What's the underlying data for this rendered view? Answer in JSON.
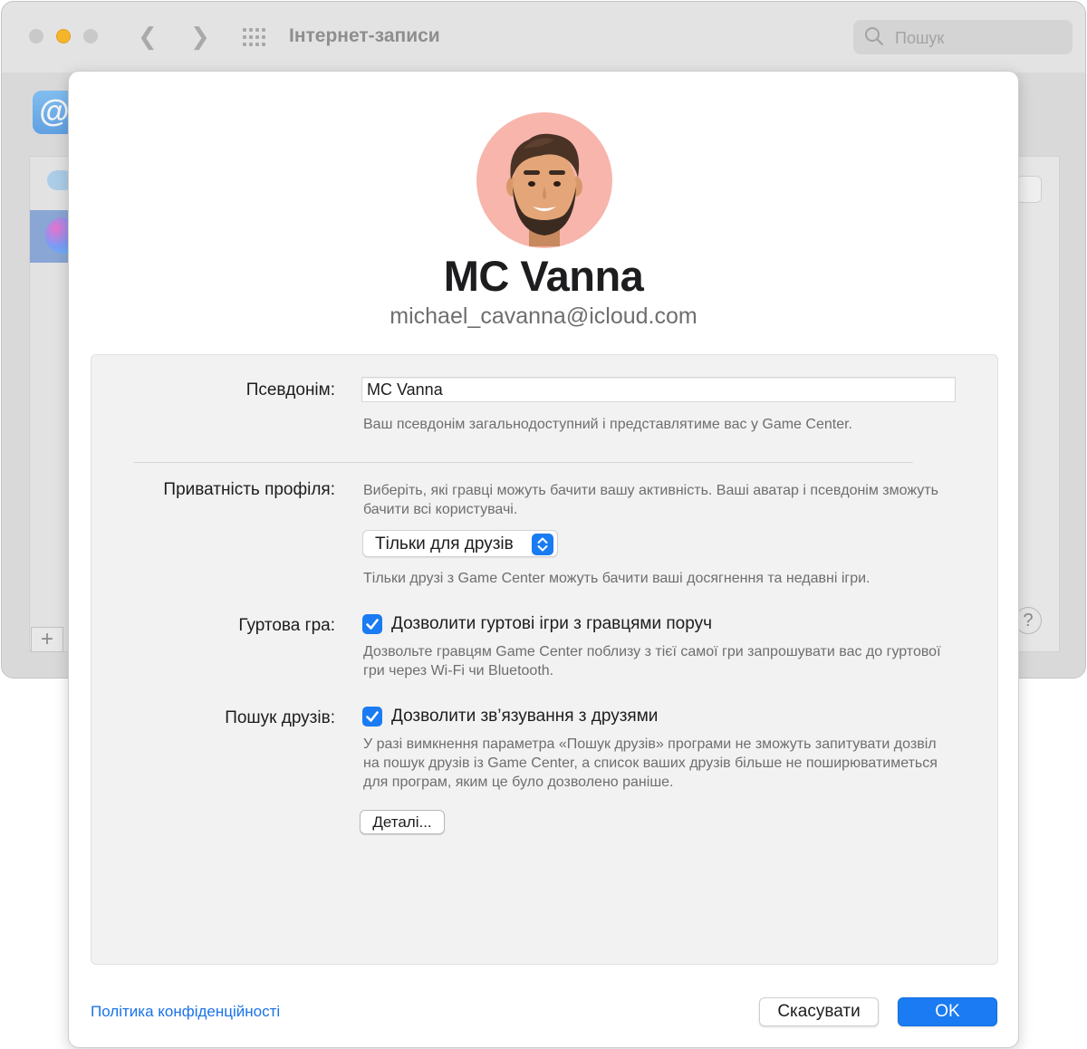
{
  "window": {
    "title": "Інтернет-записи",
    "search_placeholder": "Пошук"
  },
  "sidebar": {
    "add_label": "+",
    "help_label": "?"
  },
  "profile": {
    "name": "MC Vanna",
    "email": "michael_cavanna@icloud.com",
    "avatar_bg": "#f7b5ac"
  },
  "nickname": {
    "label": "Псевдонім:",
    "value": "MC Vanna",
    "hint": "Ваш псевдонім загальнодоступний і представлятиме вас у Game Center."
  },
  "privacy": {
    "label": "Приватність профіля:",
    "description": "Виберіть, які гравці можуть бачити вашу активність. Ваші аватар і псевдонім зможуть бачити всі користувачі.",
    "selected": "Тільки для друзів",
    "hint": "Тільки друзі з Game Center можуть бачити ваші досягнення та недавні ігри."
  },
  "multiplayer": {
    "label": "Гуртова гра:",
    "checkbox_label": "Дозволити гуртові ігри з гравцями поруч",
    "checked": true,
    "hint": "Дозвольте гравцям Game Center поблизу з тієї самої гри запрошувати вас до гуртової гри через Wi-Fi чи Bluetooth."
  },
  "friends": {
    "label": "Пошук друзів:",
    "checkbox_label": "Дозволити зв’язування з друзями",
    "checked": true,
    "hint": "У разі вимкнення параметра «Пошук друзів» програми не зможуть запитувати дозвіл на пошук друзів із Game Center, а список ваших друзів більше не поширюватиметься для програм, яким це було дозволено раніше.",
    "details_label": "Деталі..."
  },
  "footer": {
    "privacy_link": "Політика конфіденційності",
    "cancel_label": "Скасувати",
    "ok_label": "OK"
  },
  "colors": {
    "accent": "#1a7bf2",
    "link": "#1a73e8"
  }
}
